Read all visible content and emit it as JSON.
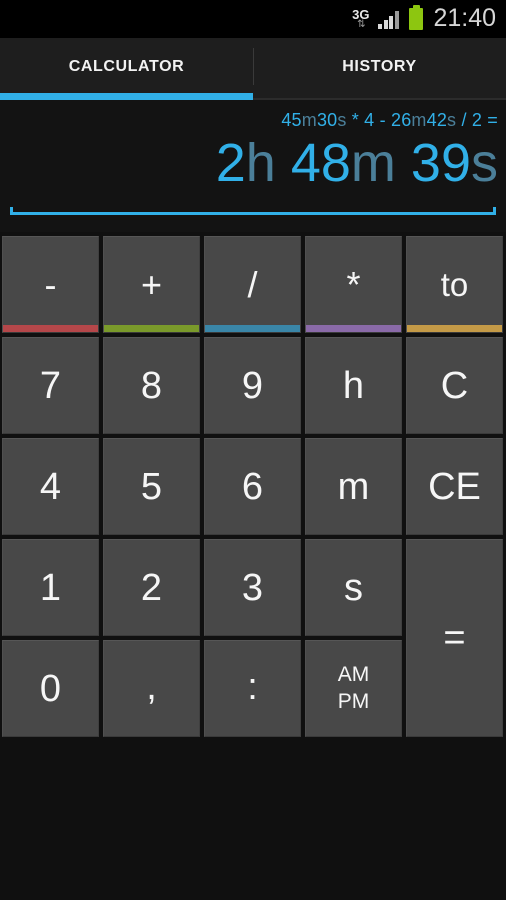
{
  "statusbar": {
    "network_type": "3G",
    "data_arrows": "⇅",
    "signal_icon": "signal-bars-icon",
    "battery_icon": "battery-full-icon",
    "clock": "21:40",
    "signal_bars_filled": 3,
    "signal_bars_total": 4
  },
  "tabs": [
    {
      "label": "CALCULATOR",
      "active": true
    },
    {
      "label": "HISTORY",
      "active": false
    }
  ],
  "display": {
    "expression_tokens": [
      {
        "text": "45",
        "kind": "num"
      },
      {
        "text": "m",
        "kind": "unit"
      },
      {
        "text": "30",
        "kind": "num"
      },
      {
        "text": "s",
        "kind": "unit"
      },
      {
        "text": " * ",
        "kind": "op"
      },
      {
        "text": "4",
        "kind": "num"
      },
      {
        "text": " - ",
        "kind": "op"
      },
      {
        "text": "26",
        "kind": "num"
      },
      {
        "text": "m",
        "kind": "unit"
      },
      {
        "text": "42",
        "kind": "num"
      },
      {
        "text": "s",
        "kind": "unit"
      },
      {
        "text": " / ",
        "kind": "op"
      },
      {
        "text": "2",
        "kind": "num"
      },
      {
        "text": " =",
        "kind": "op"
      }
    ],
    "expression_text": "45m30s * 4 - 26m42s / 2 =",
    "result_tokens": [
      {
        "text": "2",
        "kind": "num"
      },
      {
        "text": "h",
        "kind": "unit"
      },
      {
        "text": " ",
        "kind": "num"
      },
      {
        "text": "48",
        "kind": "num"
      },
      {
        "text": "m",
        "kind": "unit"
      },
      {
        "text": " ",
        "kind": "num"
      },
      {
        "text": "39",
        "kind": "num"
      },
      {
        "text": "s",
        "kind": "unit"
      }
    ],
    "result_text": "2h 48m 39s"
  },
  "keypad": {
    "rows": [
      [
        {
          "label": "-",
          "name": "key-minus",
          "accent": "#b5474a",
          "style": "op-key"
        },
        {
          "label": "+",
          "name": "key-plus",
          "accent": "#7a9a2b",
          "style": "op-key"
        },
        {
          "label": "/",
          "name": "key-divide",
          "accent": "#3a86a8",
          "style": "op-key"
        },
        {
          "label": "*",
          "name": "key-multiply",
          "accent": "#8a6aa8",
          "style": "op-key"
        },
        {
          "label": "to",
          "name": "key-to",
          "accent": "#c49a47",
          "style": "word"
        }
      ],
      [
        {
          "label": "7",
          "name": "key-7",
          "style": ""
        },
        {
          "label": "8",
          "name": "key-8",
          "style": ""
        },
        {
          "label": "9",
          "name": "key-9",
          "style": ""
        },
        {
          "label": "h",
          "name": "key-hours",
          "style": ""
        },
        {
          "label": "C",
          "name": "key-clear",
          "style": ""
        }
      ],
      [
        {
          "label": "4",
          "name": "key-4",
          "style": ""
        },
        {
          "label": "5",
          "name": "key-5",
          "style": ""
        },
        {
          "label": "6",
          "name": "key-6",
          "style": ""
        },
        {
          "label": "m",
          "name": "key-minutes",
          "style": ""
        },
        {
          "label": "CE",
          "name": "key-clear-entry",
          "style": ""
        }
      ],
      [
        {
          "label": "1",
          "name": "key-1",
          "style": ""
        },
        {
          "label": "2",
          "name": "key-2",
          "style": ""
        },
        {
          "label": "3",
          "name": "key-3",
          "style": ""
        },
        {
          "label": "s",
          "name": "key-seconds",
          "style": ""
        }
      ],
      [
        {
          "label": "0",
          "name": "key-0",
          "style": ""
        },
        {
          "label": ",",
          "name": "key-comma",
          "style": "comma"
        },
        {
          "label": ":",
          "name": "key-colon",
          "style": "colon"
        },
        {
          "label": "AM\nPM",
          "name": "key-am-pm",
          "style": "small"
        }
      ]
    ],
    "equals": {
      "label": "=",
      "name": "key-equals"
    }
  },
  "colors": {
    "accent_blue": "#31b0e8",
    "unit_blue": "#4b7f99",
    "key_face": "#484848",
    "background": "#101010",
    "tabbar": "#1e1e1e",
    "battery_green": "#8dc610"
  }
}
